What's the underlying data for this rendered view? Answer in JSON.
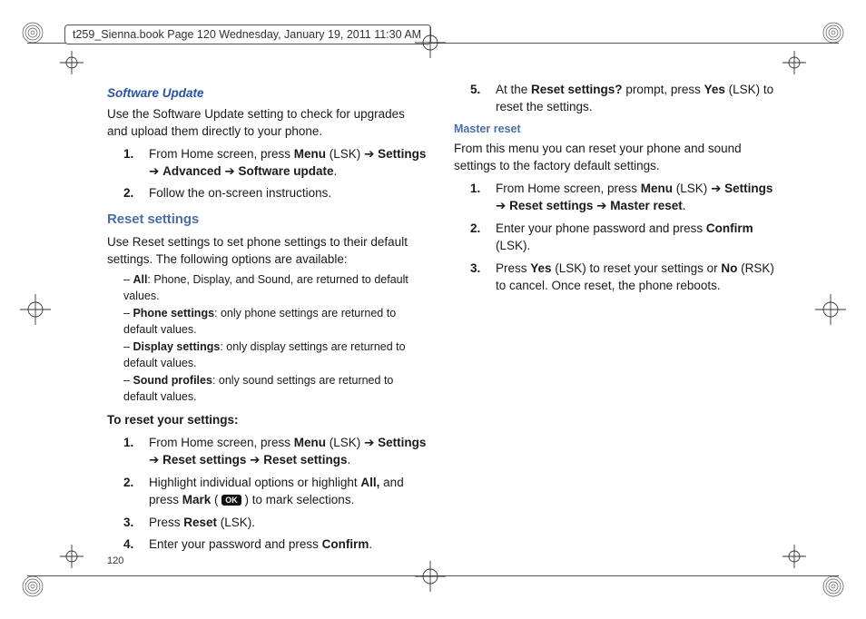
{
  "header": "t259_Sienna.book  Page 120  Wednesday, January 19, 2011  11:30 AM",
  "page_number": "120",
  "arrow": "➔",
  "ok_label": "OK",
  "col1": {
    "h1": "Software Update",
    "p1": "Use the Software Update setting to check for upgrades and upload them directly to your phone.",
    "s1_1a": "From Home screen, press ",
    "s1_1b": "Menu",
    "s1_1c": " (LSK) ",
    "s1_1d": "Settings",
    "s1_1e": "Advanced",
    "s1_1f": "Software update",
    "s1_2": "Follow the on-screen instructions.",
    "h2": "Reset settings",
    "p2": "Use Reset settings to set phone settings to their default settings. The following options are available:",
    "d1a": "All",
    "d1b": ": Phone, Display, and Sound, are returned to default values.",
    "d2a": "Phone settings",
    "d2b": ": only phone settings are returned to default values.",
    "d3a": "Display settings",
    "d3b": ": only display settings are returned to default values.",
    "d4a": "Sound profiles",
    "d4b": ": only sound settings are returned to default values.",
    "lead2": "To reset your settings:",
    "r1a": "From Home screen, press ",
    "r1b": "Menu",
    "r1c": " (LSK) ",
    "r1d": "Settings",
    "r1e": "Reset settings",
    "r1f": "Reset settings",
    "r2a": "Highlight individual options or highlight ",
    "r2b": "All,",
    "r2c": " and press ",
    "r2d": "Mark",
    "r2e": " ( ",
    "r2f": " ) to mark selections.",
    "r3a": "Press ",
    "r3b": "Reset",
    "r3c": " (LSK).",
    "r4a": "Enter your password and press ",
    "r4b": "Confirm",
    "r4c": "."
  },
  "col2": {
    "r5a": "At the ",
    "r5b": "Reset settings?",
    "r5c": " prompt, press ",
    "r5d": "Yes",
    "r5e": " (LSK) to reset the settings.",
    "h3": "Master reset",
    "p3": "From this menu you can reset your phone and sound settings to the factory default settings.",
    "m1a": "From Home screen, press ",
    "m1b": "Menu",
    "m1c": " (LSK) ",
    "m1d": "Settings",
    "m1e": "Reset settings",
    "m1f": "Master reset",
    "m2a": "Enter your phone password and press ",
    "m2b": "Confirm",
    "m2c": " (LSK).",
    "m3a": "Press ",
    "m3b": "Yes",
    "m3c": " (LSK) to reset your settings or ",
    "m3d": "No",
    "m3e": " (RSK) to cancel. Once reset, the phone reboots."
  }
}
